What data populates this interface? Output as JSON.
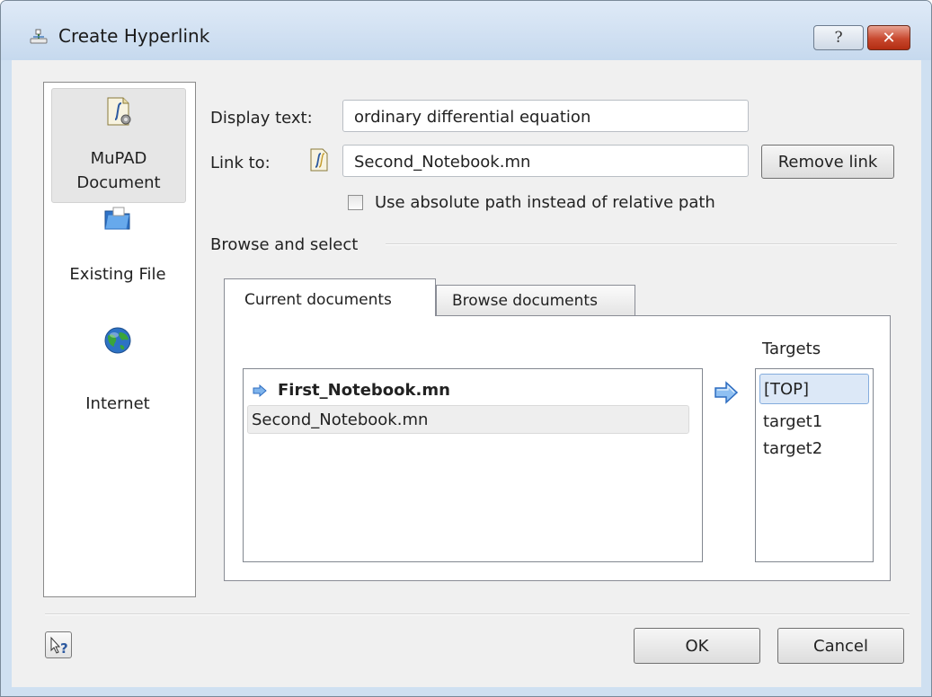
{
  "window": {
    "title": "Create Hyperlink",
    "help_button_label": "?",
    "close_button_label": "✕"
  },
  "sidebar": {
    "items": [
      {
        "label": "MuPAD Document",
        "icon": "mupad-document-icon",
        "selected": true
      },
      {
        "label": "Existing File",
        "icon": "folder-icon",
        "selected": false
      },
      {
        "label": "Internet",
        "icon": "globe-icon",
        "selected": false
      }
    ]
  },
  "form": {
    "display_text_label": "Display text:",
    "display_text_value": "ordinary differential equation",
    "link_to_label": "Link to:",
    "link_to_value": "Second_Notebook.mn",
    "remove_link_label": "Remove link",
    "absolute_path_label": "Use absolute path instead of relative path",
    "absolute_path_checked": false
  },
  "browse": {
    "group_label": "Browse and select",
    "tabs": [
      {
        "label": "Current documents",
        "active": true
      },
      {
        "label": "Browse documents",
        "active": false
      }
    ],
    "documents": [
      {
        "name": "First_Notebook.mn",
        "current": true
      },
      {
        "name": "Second_Notebook.mn",
        "current": false
      }
    ],
    "targets_label": "Targets",
    "targets": [
      "[TOP]",
      "target1",
      "target2"
    ]
  },
  "footer": {
    "ok_label": "OK",
    "cancel_label": "Cancel"
  },
  "colors": {
    "accent": "#3c7fd1",
    "selection": "#dce8f7"
  }
}
